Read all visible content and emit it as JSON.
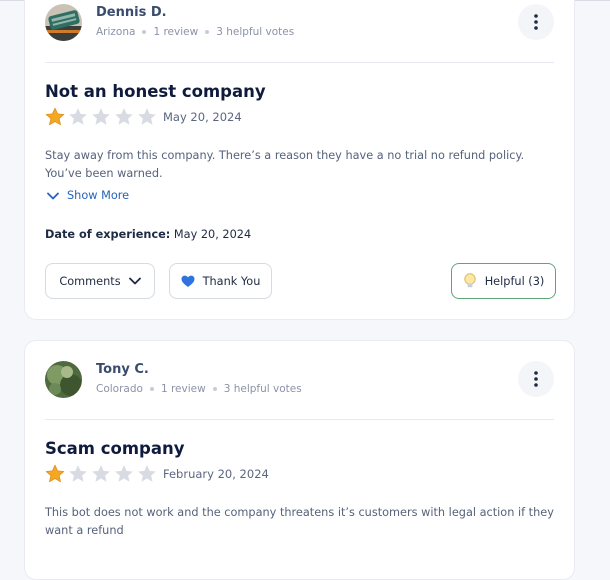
{
  "reviews": [
    {
      "author": "Dennis D.",
      "location": "Arizona",
      "review_count": "1 review",
      "helpful_votes": "3 helpful votes",
      "title": "Not an honest company",
      "rating": 1,
      "max_rating": 5,
      "date": "May 20, 2024",
      "body": "Stay away from this company. There’s a reason they have a no trial no refund policy. You’ve been warned.",
      "show_more": "Show More",
      "experience_label": "Date of experience:",
      "experience_date": "May 20, 2024",
      "actions": {
        "comments": "Comments",
        "thank_you": "Thank You",
        "helpful": "Helpful (3)"
      }
    },
    {
      "author": "Tony C.",
      "location": "Colorado",
      "review_count": "1 review",
      "helpful_votes": "3 helpful votes",
      "title": "Scam company",
      "rating": 1,
      "max_rating": 5,
      "date": "February 20, 2024",
      "body": "This bot does not work and the company threatens it’s customers with legal action if they want a refund"
    }
  ],
  "colors": {
    "star_filled": "#f5a623",
    "star_empty": "#d8dbe1",
    "link": "#2563b8",
    "helpful_border": "#5ea67a"
  },
  "icons": [
    "more-vertical-icon",
    "star-icon",
    "chevron-down-icon",
    "blue-heart-icon",
    "lightbulb-icon"
  ]
}
